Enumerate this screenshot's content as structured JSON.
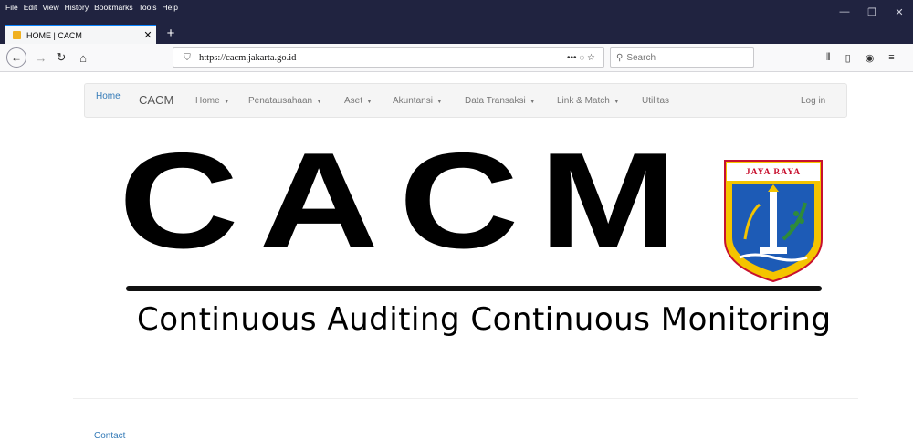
{
  "browser": {
    "menu": [
      "File",
      "Edit",
      "View",
      "History",
      "Bookmarks",
      "Tools",
      "Help"
    ],
    "tab_title": "HOME | CACM",
    "url": "https://cacm.jakarta.go.id",
    "page_actions": "•••  ◌  ☆",
    "search_placeholder": "Search"
  },
  "site_nav": {
    "home_link": "Home",
    "brand": "CACM",
    "items": [
      {
        "label": "Home"
      },
      {
        "label": "Penatausahaan"
      },
      {
        "label": "Aset"
      },
      {
        "label": "Akuntansi"
      },
      {
        "label": "Data Transaksi"
      },
      {
        "label": "Link & Match"
      },
      {
        "label": "Utilitas"
      }
    ],
    "login": "Log in"
  },
  "hero": {
    "title": "CACM",
    "subtitle": "Continuous Auditing Continuous Monitoring",
    "emblem_label": "JAYA RAYA"
  },
  "footer": {
    "contact": "Contact"
  },
  "colors": {
    "chrome_dark": "#202340",
    "link_blue": "#337ab7",
    "emblem_red": "#c8102e",
    "emblem_blue": "#1d5bb6",
    "emblem_yellow": "#f4c400"
  }
}
